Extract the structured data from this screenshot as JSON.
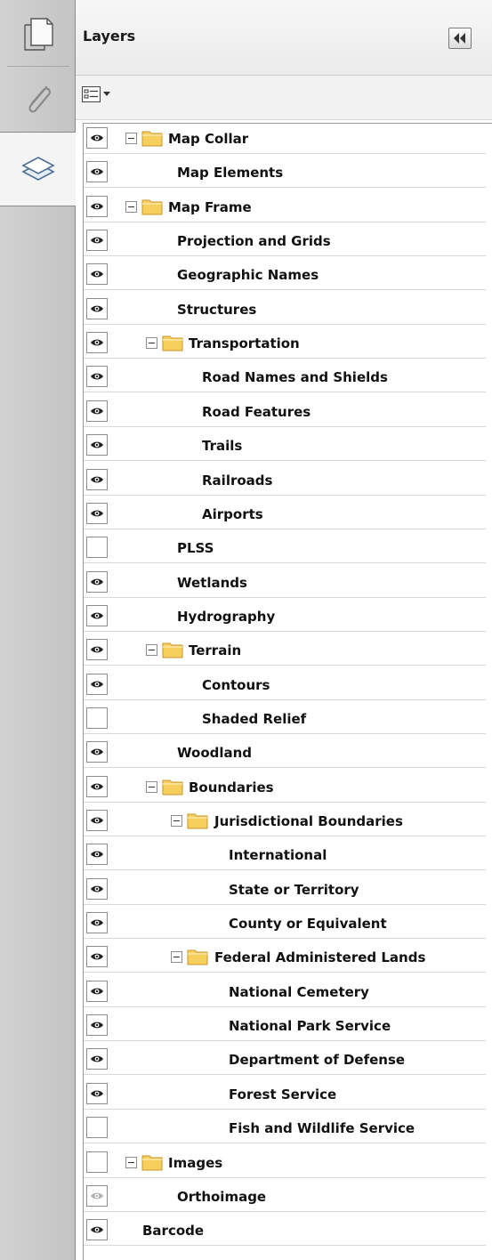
{
  "panel": {
    "title": "Layers"
  },
  "layers": [
    {
      "label": "Map Collar",
      "visible": true,
      "folder": true,
      "level": 0
    },
    {
      "label": "Map Elements",
      "visible": true,
      "folder": false,
      "level": 1
    },
    {
      "label": "Map Frame",
      "visible": true,
      "folder": true,
      "level": 0
    },
    {
      "label": "Projection and Grids",
      "visible": true,
      "folder": false,
      "level": 1
    },
    {
      "label": "Geographic Names",
      "visible": true,
      "folder": false,
      "level": 1
    },
    {
      "label": "Structures",
      "visible": true,
      "folder": false,
      "level": 1
    },
    {
      "label": "Transportation",
      "visible": true,
      "folder": true,
      "level": 1
    },
    {
      "label": "Road Names and Shields",
      "visible": true,
      "folder": false,
      "level": 2
    },
    {
      "label": "Road Features",
      "visible": true,
      "folder": false,
      "level": 2
    },
    {
      "label": "Trails",
      "visible": true,
      "folder": false,
      "level": 2
    },
    {
      "label": "Railroads",
      "visible": true,
      "folder": false,
      "level": 2
    },
    {
      "label": "Airports",
      "visible": true,
      "folder": false,
      "level": 2
    },
    {
      "label": "PLSS",
      "visible": false,
      "folder": false,
      "level": 1
    },
    {
      "label": "Wetlands",
      "visible": true,
      "folder": false,
      "level": 1
    },
    {
      "label": "Hydrography",
      "visible": true,
      "folder": false,
      "level": 1
    },
    {
      "label": "Terrain",
      "visible": true,
      "folder": true,
      "level": 1
    },
    {
      "label": "Contours",
      "visible": true,
      "folder": false,
      "level": 2
    },
    {
      "label": "Shaded Relief",
      "visible": false,
      "folder": false,
      "level": 2
    },
    {
      "label": "Woodland",
      "visible": true,
      "folder": false,
      "level": 1
    },
    {
      "label": "Boundaries",
      "visible": true,
      "folder": true,
      "level": 1
    },
    {
      "label": "Jurisdictional Boundaries",
      "visible": true,
      "folder": true,
      "level": 2
    },
    {
      "label": "International",
      "visible": true,
      "folder": false,
      "level": 3
    },
    {
      "label": "State or Territory",
      "visible": true,
      "folder": false,
      "level": 3
    },
    {
      "label": "County or Equivalent",
      "visible": true,
      "folder": false,
      "level": 3
    },
    {
      "label": "Federal Administered Lands",
      "visible": true,
      "folder": true,
      "level": 2
    },
    {
      "label": "National Cemetery",
      "visible": true,
      "folder": false,
      "level": 3
    },
    {
      "label": "National Park Service",
      "visible": true,
      "folder": false,
      "level": 3
    },
    {
      "label": "Department of Defense",
      "visible": true,
      "folder": false,
      "level": 3
    },
    {
      "label": "Forest Service",
      "visible": true,
      "folder": false,
      "level": 3
    },
    {
      "label": "Fish and Wildlife Service",
      "visible": false,
      "folder": false,
      "level": 3
    },
    {
      "label": "Images",
      "visible": false,
      "folder": true,
      "level": 0
    },
    {
      "label": "Orthoimage",
      "visible": "dimmed",
      "folder": false,
      "level": 1
    },
    {
      "label": "Barcode",
      "visible": true,
      "folder": false,
      "level": 0.5
    }
  ],
  "icons": {
    "rail_pages": "pages-icon",
    "rail_attachments": "paperclip-icon",
    "rail_layers": "layers-icon",
    "collapse": "double-chevron-left-icon",
    "options": "layer-options-icon",
    "visibility": "eye-icon",
    "folder": "folder-icon",
    "expander": "collapse-minus-icon"
  },
  "colors": {
    "folder_fill": "#f6cf5c",
    "eye": "#222222",
    "eye_dimmed": "#b0b0b0"
  }
}
